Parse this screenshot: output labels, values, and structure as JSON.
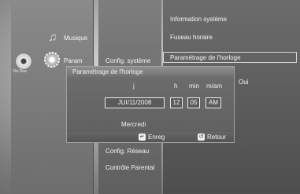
{
  "left_menu": {
    "disc_label": "No Disc",
    "items": [
      "Musique",
      "Param"
    ]
  },
  "middle_menu": {
    "items": [
      "Config. système",
      "Config. Réseau",
      "Contrôle Parental"
    ]
  },
  "right_menu": {
    "items": [
      "Information système",
      "Fuseau horaire",
      "Paramétrage de l'horloge"
    ],
    "partial_item": "Oui"
  },
  "dialog": {
    "title": "Paramétrage de l'horloge",
    "headers": {
      "date": "j",
      "hour": "h",
      "minute": "min",
      "ampm": "m/am"
    },
    "values": {
      "date": "JUI/11/2008",
      "hour": "12",
      "minute": "05",
      "ampm": "AM"
    },
    "weekday": "Mercredi",
    "footer": {
      "save_label": "Enreg",
      "back_label": "Retour"
    }
  },
  "icons": {
    "music": "music-note-icon",
    "settings": "gear-icon",
    "disc": "disc-icon",
    "save": "enter-key-icon",
    "back": "return-key-icon"
  }
}
